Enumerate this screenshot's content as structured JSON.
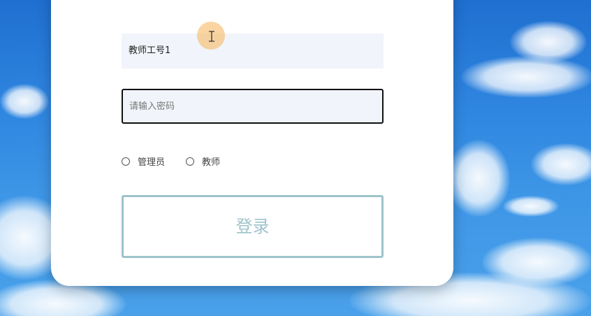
{
  "login_form": {
    "account_value": "教师工号1",
    "password_placeholder": "请输入密码",
    "roles": [
      {
        "label": "管理员",
        "selected": false
      },
      {
        "label": "教师",
        "selected": false
      }
    ],
    "login_button_label": "登录"
  },
  "colors": {
    "accent_button": "#9ec3cb",
    "field_bg": "#f1f4fa",
    "cursor_highlight": "#f7be6e"
  },
  "icons": {
    "cursor": "text-cursor-icon"
  }
}
